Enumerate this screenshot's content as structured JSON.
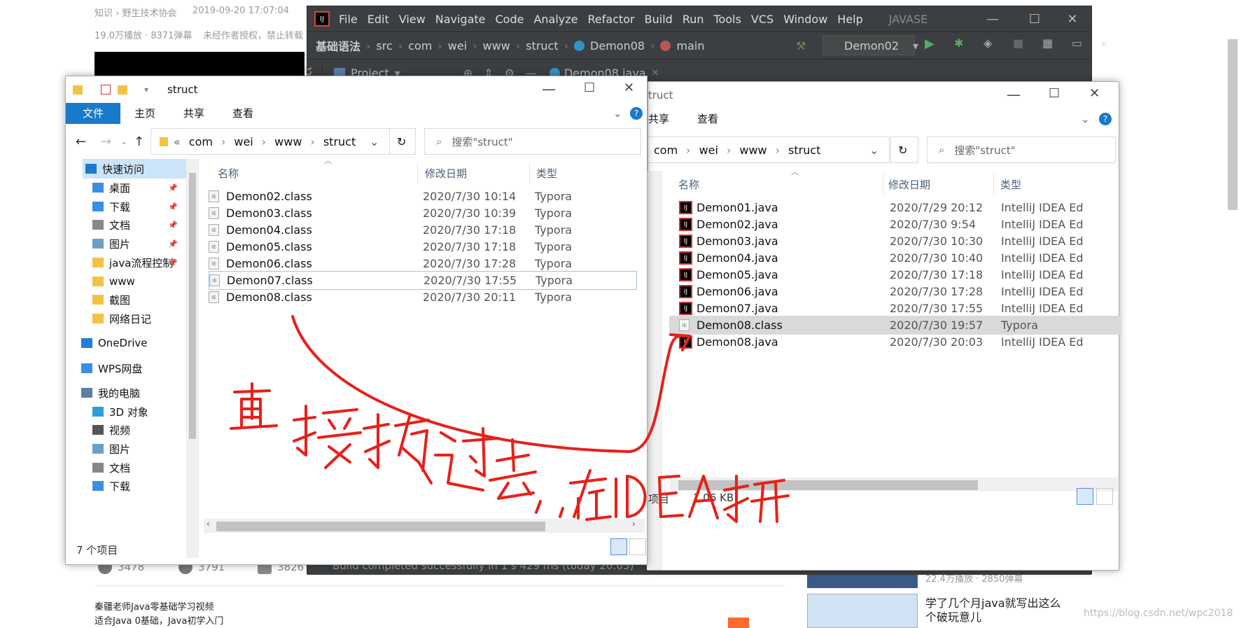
{
  "background": {
    "breadcrumb": "知识 › 野生技术协会",
    "date": "2019-09-20 17:07:04",
    "play_stats": "19.0万播放 · 8371弹幕",
    "license": "未经作者授权，禁止转载",
    "likes": "3478",
    "coins": "3791",
    "favs": "3826",
    "desc_line1": "秦疆老师Java零基础学习视频",
    "desc_line2": "适合Java 0基础，Java初学入门",
    "rec_title1": "学了几个月java就写出这么",
    "rec_title2": "个破玩意儿",
    "rec_stats": "22.4万播放 · 2850弹幕",
    "watermark": "https://blog.csdn.net/wpc2018"
  },
  "idea": {
    "menu": [
      "File",
      "Edit",
      "View",
      "Navigate",
      "Code",
      "Analyze",
      "Refactor",
      "Build",
      "Run",
      "Tools",
      "VCS",
      "Window",
      "Help"
    ],
    "project_name": "JAVASE",
    "breadcrumb": [
      "基础语法",
      "src",
      "com",
      "wei",
      "www",
      "struct",
      "Demon08",
      "main"
    ],
    "run_config": "Demon02",
    "project_tab": "Project",
    "side_tab": "ject",
    "editor_tab": "Demon08.java",
    "status": "Build completed successfully in 1 s 429 ms (today 20:03)"
  },
  "left_explorer": {
    "title": "struct",
    "ribbon_tabs": [
      "文件",
      "主页",
      "共享",
      "查看"
    ],
    "path": [
      "«",
      "com",
      "wei",
      "www",
      "struct"
    ],
    "search_placeholder": "搜索\"struct\"",
    "columns": {
      "name": "名称",
      "date": "修改日期",
      "type": "类型"
    },
    "files": [
      {
        "name": "Demon02.class",
        "date": "2020/7/30 10:14",
        "type": "Typora"
      },
      {
        "name": "Demon03.class",
        "date": "2020/7/30 10:39",
        "type": "Typora"
      },
      {
        "name": "Demon04.class",
        "date": "2020/7/30 17:18",
        "type": "Typora"
      },
      {
        "name": "Demon05.class",
        "date": "2020/7/30 17:18",
        "type": "Typora"
      },
      {
        "name": "Demon06.class",
        "date": "2020/7/30 17:28",
        "type": "Typora"
      },
      {
        "name": "Demon07.class",
        "date": "2020/7/30 17:55",
        "type": "Typora"
      },
      {
        "name": "Demon08.class",
        "date": "2020/7/30 20:11",
        "type": "Typora"
      }
    ],
    "nav": [
      "快速访问",
      "桌面",
      "下载",
      "文档",
      "图片",
      "java流程控制",
      "www",
      "截图",
      "网络日记",
      "OneDrive",
      "WPS网盘",
      "我的电脑",
      "3D 对象",
      "视频",
      "图片",
      "文档",
      "下载"
    ],
    "status": "7 个项目"
  },
  "right_explorer": {
    "title": "struct",
    "ribbon_tabs": [
      "共享",
      "查看"
    ],
    "path": [
      "«",
      "com",
      "wei",
      "www",
      "struct"
    ],
    "search_placeholder": "搜索\"struct\"",
    "columns": {
      "name": "名称",
      "date": "修改日期",
      "type": "类型"
    },
    "files": [
      {
        "name": "Demon01.java",
        "date": "2020/7/29 20:12",
        "type": "IntelliJ IDEA Ed",
        "kind": "java"
      },
      {
        "name": "Demon02.java",
        "date": "2020/7/30 9:54",
        "type": "IntelliJ IDEA Ed",
        "kind": "java"
      },
      {
        "name": "Demon03.java",
        "date": "2020/7/30 10:30",
        "type": "IntelliJ IDEA Ed",
        "kind": "java"
      },
      {
        "name": "Demon04.java",
        "date": "2020/7/30 10:40",
        "type": "IntelliJ IDEA Ed",
        "kind": "java"
      },
      {
        "name": "Demon05.java",
        "date": "2020/7/30 17:18",
        "type": "IntelliJ IDEA Ed",
        "kind": "java"
      },
      {
        "name": "Demon06.java",
        "date": "2020/7/30 17:28",
        "type": "IntelliJ IDEA Ed",
        "kind": "java"
      },
      {
        "name": "Demon07.java",
        "date": "2020/7/30 17:55",
        "type": "IntelliJ IDEA Ed",
        "kind": "java"
      },
      {
        "name": "Demon08.class",
        "date": "2020/7/30 19:57",
        "type": "Typora",
        "kind": "class"
      },
      {
        "name": "Demon08.java",
        "date": "2020/7/30 20:03",
        "type": "IntelliJ IDEA Ed",
        "kind": "java"
      }
    ],
    "status_left": "项目",
    "status_size": "1.06 KB"
  },
  "annotation": "直接拖过去，在IDEA打开",
  "colors": {
    "ribbon_blue": "#1979ca",
    "annotation_red": "#e8201a",
    "idea_bg": "#3c3f41"
  }
}
